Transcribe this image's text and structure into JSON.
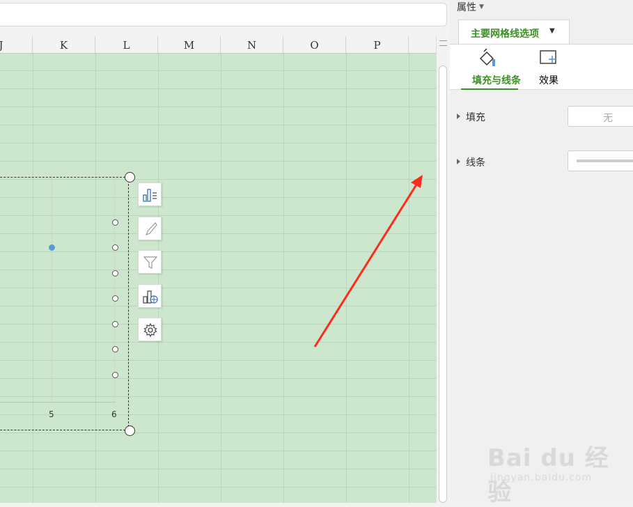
{
  "columns": [
    "J",
    "K",
    "L",
    "M",
    "N",
    "O",
    "P"
  ],
  "chart": {
    "x_tick_labels": [
      "5",
      "6"
    ],
    "data_point_color": "#5b9bd5",
    "tools": [
      {
        "name": "chart-elements-icon"
      },
      {
        "name": "chart-style-brush-icon"
      },
      {
        "name": "chart-filter-icon"
      },
      {
        "name": "chart-online-icon"
      },
      {
        "name": "chart-settings-icon"
      }
    ]
  },
  "panel": {
    "title": "属性",
    "main_tab": "主要网格线选项",
    "subtabs": [
      {
        "label": "填充与线条",
        "icon": "paint-bucket-icon",
        "active": true
      },
      {
        "label": "效果",
        "icon": "effects-icon",
        "active": false
      }
    ],
    "fill": {
      "label": "填充",
      "value": "无"
    },
    "line": {
      "label": "线条"
    }
  },
  "watermark": {
    "logo": "Bai du 经验",
    "url": "jingyan.baidu.com"
  },
  "colors": {
    "sheet_bg": "#cde7cf",
    "accent": "#3f8f27",
    "arrow": "#ff2a1a"
  }
}
